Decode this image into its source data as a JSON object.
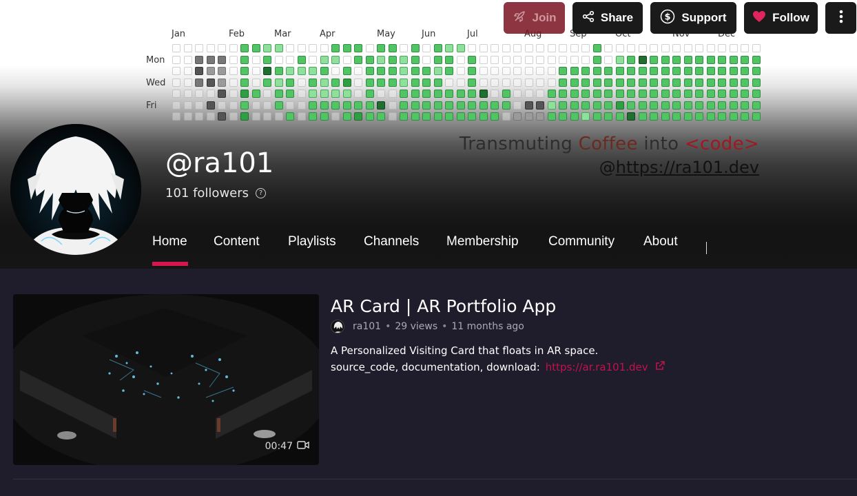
{
  "actions": {
    "join_label": "Join",
    "share_label": "Share",
    "support_label": "Support",
    "follow_label": "Follow"
  },
  "calendar": {
    "months": [
      "Jan",
      "Feb",
      "Mar",
      "Apr",
      "May",
      "Jun",
      "Jul",
      "Aug",
      "Sep",
      "Oct",
      "Nov",
      "Dec"
    ],
    "days": [
      "Mon",
      "Wed",
      "Fri"
    ],
    "weeks": [
      "0000000",
      "0000000",
      "0g2g3g200",
      "0g2g1g30g3",
      "0g2g1g1g30g3",
      "0",
      "c2c2c2c2c3c2c3",
      "c2000c200",
      "c1c2c4c2000",
      "c10c2c1c2c20",
      "00c1c2c20c2c4",
      "0c2c1000",
      "00c1c2c1c2c2c2",
      "0c1c2c1c1c2c2",
      "c2c10c2c1c20",
      "c20c2c3c1c2c2",
      "c2c2000c2c3",
      "0c2c2c2c2c2c2",
      "c2c1c2c20c4c2",
      "c2c2c2c2000",
      "0c1c1c1c2c2c2",
      "c2c2c2c2c2c2c2",
      "00c2c2c2c2c2",
      "c2c2c1c2c2c2c2",
      "c1c2c20c2c2c2",
      "c1000c2c2c2",
      "0c2c2c2c2c2c2",
      "0000c4c2c2",
      "00000c2c2",
      "0000c2c20",
      "000000g1",
      "00000g3g1",
      "00000g3g1",
      "0000c2c1c2",
      "00c2c2c2c2c2",
      "00c2c2c2c2c2",
      "00c2c2c2c2c1",
      "c2c2c2c2c2c2c2",
      "00c2c2c2c2c2",
      "0c1c2c2c2c3c2",
      "0c2c2c2c2c2c4",
      "0c4c2c2c2c2c2",
      "0c2c2c2c2c2c2",
      "0c2c2c2c2c2c2",
      "0c2c2c2c2c2c2",
      "0c2c2c2c2c2c2",
      "0c2c2c2c2c2c2",
      "0c2c2c2c2c2c2",
      "0c2c2c2c2c2c2",
      "0c2c2c2c2c2c2",
      "0c2c2c2c2c2c2",
      "0c2c2c2c2c2c2"
    ]
  },
  "banner": {
    "tagline_prefix": "Transmuting ",
    "tagline_coffee": "Coffee",
    "tagline_mid": " into ",
    "tagline_code": "<code>",
    "site_at": "@",
    "site_url": "https://ra101.dev"
  },
  "profile": {
    "handle": "@ra101",
    "followers": "101 followers"
  },
  "tabs": [
    "Home",
    "Content",
    "Playlists",
    "Channels",
    "Membership",
    "Community",
    "About"
  ],
  "video": {
    "title": "AR Card | AR Portfolio App",
    "author": "ra101",
    "views": "29 views",
    "age": "11 months ago",
    "duration": "00:47",
    "desc_line1": "A Personalized Visiting Card that floats in AR space.",
    "desc_line2_prefix": "source_code, documentation, download:",
    "desc_link": "https://ar.ra101.dev"
  },
  "colors": {
    "accent": "#d6164f",
    "link": "#c2134d",
    "join_bg": "#7a1322",
    "page_bg": "#1f1c2b"
  }
}
